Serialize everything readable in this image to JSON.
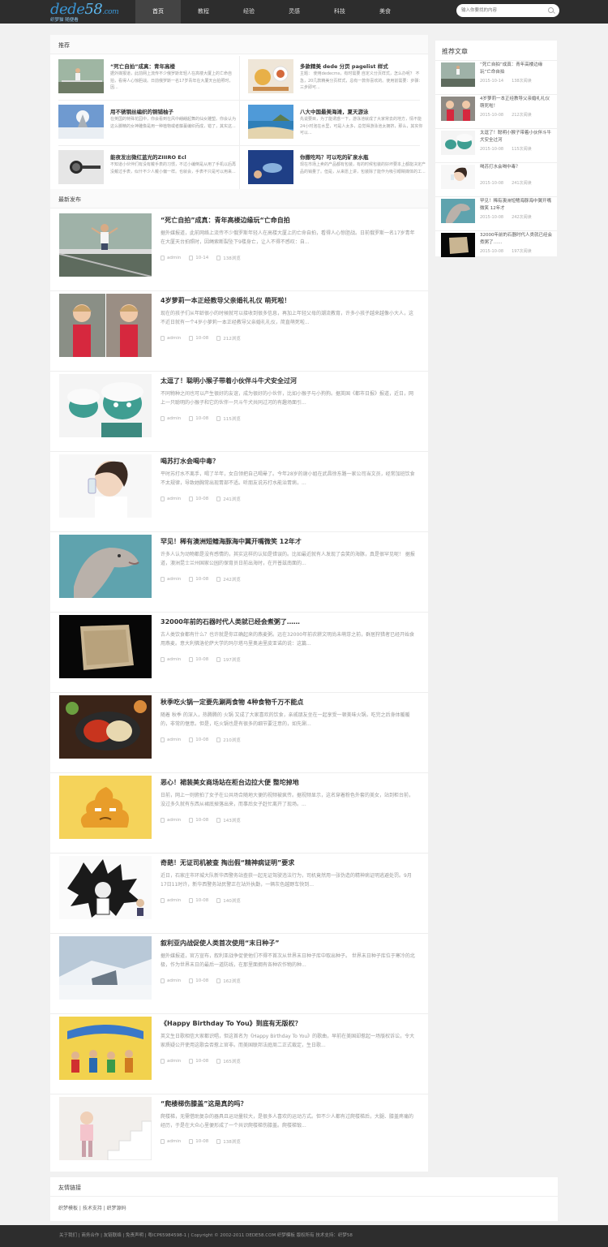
{
  "brand": {
    "logo_a": "dede",
    "logo_b": "58",
    "logo_c": ".com",
    "tagline": "织梦猫 随便看"
  },
  "nav": [
    "首页",
    "教程",
    "经验",
    "灵感",
    "科技",
    "美食"
  ],
  "search": {
    "placeholder": "输入你要找的内容"
  },
  "featured": {
    "title": "推荐",
    "items": [
      {
        "title": "“死亡自拍”成真：青年高楼",
        "desc": "据外媒报道，此前网上流传不少俄罗斯年轻人在高楼大厦上的亡命自拍，看得人心惊胆战。日前俄罗斯一名17岁青年在大厦天台拍照时，因..."
      },
      {
        "title": "多款精美 dede 分页 pagelist 样式",
        "desc": "主题： 使用dedecms，有时需要 自定义分页样式，怎么办呢？ 不急，20几款精美分页样式，总有一款你喜欢的。使用前需要：步骤：三步即可..."
      },
      {
        "title": "用不锈钢丝编织的铜铺柚子",
        "desc": "在英国的特殊花园中，你会看到在风中翩翩起舞的仙女雕塑。你会认为这么脚精的女神雕像是用一种植物或者藤蔓编织而成，错了，其实这..."
      },
      {
        "title": "八大中国最美海滩，夏天游泳",
        "desc": "先说要目，为了能诱惑一下，游泳池就成了大家常去的地方，情不能24小时泡在水里，可是人太多，总觉得游泳池太拥挤，那么，其实你可以..."
      },
      {
        "title": "能夜发出微红蓝光的ZIIIRO Ecl",
        "desc": "不知道小伙伴们有没有戴手表的习惯，不过小编倒是从用了手机以后再没戴过手表，似什不少人戴小偏一样。也就会，手表不只是可以用来..."
      },
      {
        "title": "你撒吃吗？可以吃的矿泉水瓶",
        "desc": "现在市场上卖的产品都有包装，有的时候包装的好坏要本上都能决定产品的销量了。但是，从来愿上讲，包装除了能作为吸引眼睛媒体的工..."
      }
    ]
  },
  "latest": {
    "title": "最新发布",
    "items": [
      {
        "title": "“死亡自拍”成真：青年高楼边缘玩“亡命自拍",
        "desc": "据外媒报道，此前网络上流传不少俄罗斯年轻人在高楼大厦上的亡命自拍，看得人心惊胆战。日前俄罗斯一名17岁青年在大厦天台拍照时，因绳索断裂坠下9楼身亡，让人不得不感叹：自...",
        "author": "admin",
        "date": "10-14",
        "views": "138浏览"
      },
      {
        "title": "4岁萝莉一本正经教导父亲婚礼礼仪 萌死啦！",
        "desc": "现在的孩子们从年龄很小的时候就可以接收到很多信息，再加上年轻父母的潮流教育，许多小孩子越来越像小大人，这不近日就有一个4岁小萝莉一本正经教导父亲婚礼礼仪，简直萌死啦...",
        "author": "admin",
        "date": "10-08",
        "views": "212浏览"
      },
      {
        "title": "太逗了！聪明小猴子带着小伙伴斗牛犬安全过河",
        "desc": "不同物种之间也可以产生很好的友谊，成为很好的小伙伴，比如小猴子与小狗狗。据英国《都市日报》报道，近日，网上一只聪明的小猴子和它的伙伴一只斗牛犬共同过河的有趣场面引...",
        "author": "admin",
        "date": "10-08",
        "views": "115浏览"
      },
      {
        "title": "喝苏打水会喝中毒？",
        "desc": "平时苏打水不离手，喝了半年，女白领把自己喝晕了。今年28岁的谢小姐在武昌徐东路一家公司当文员，经常加班饮食不太规律，导致她胸常出现胃部不适。听朋友说苏打水能治胃病，...",
        "author": "admin",
        "date": "10-08",
        "views": "241浏览"
      },
      {
        "title": "罕见！稀有澳洲短鳍海豚海中翼开嘴微笑 12年才",
        "desc": "许多人认为动物都是没有感情的，其实这样的认知是错误的。比如最近就有人发现了会笑的海豚，真是很罕见呢！ 据报道，澳洲昆士兰州国家公园的保育员日前出海时，在开普兹南面的...",
        "author": "admin",
        "date": "10-08",
        "views": "242浏览"
      },
      {
        "title": "32000年前的石器时代人类就已经会煮粥了……",
        "desc": "古人类饮食都有什么？也许就是你正确起来的燕麦粥。远在32000年前农耕文明尚未萌芽之前，群居狩猎者已经开始食用燕麦。意大利佛洛伦萨大学的玛尔塔马里奥迪里皮亚诺的说：这篇...",
        "author": "admin",
        "date": "10-08",
        "views": "197浏览"
      },
      {
        "title": "秋季吃火锅一定要先涮两食物 4种食物千万不能点",
        "desc": "随着 秋季 的深入，热腾腾的 火锅 又成了大家喜欢的饮食，亲戚朋友坐在一起享受一顿美味火锅，吃完之后身体暖暖的，非常的惬意。但是，吃火锅也是有很多的细节要注意的，如先涮...",
        "author": "admin",
        "date": "10-08",
        "views": "210浏览"
      },
      {
        "title": "恶心！裙装美女商场站在柜台边拉大便 整坨掉地",
        "desc": "日前，网上一则俯拍了女子在公共场合随地大便的视频被疯传。据视频显示，这名穿着粉色外套的美女，站到柜台前，没过多久就有东西从裙底掉落出来，而事后女子赶忙离开了现场。...",
        "author": "admin",
        "date": "10-08",
        "views": "143浏览"
      },
      {
        "title": "奇葩！无证司机被查 掏出假“精神病证明”要求",
        "desc": "近日，石家庄市环城大队新华西警务站查获一起无证驾驶违法行为，司机竟然用一张伪造的精神病证明逃避处罚。9月17日11时许，新华西警务站民警正在站外执勤，一辆灰色越野车快到...",
        "author": "admin",
        "date": "10-08",
        "views": "140浏览"
      },
      {
        "title": "叙利亚内战促使人类首次使用“末日种子”",
        "desc": "据外媒报道，官方宣布，叙利亚战争促使他们不得不首次从世界末日种子库中取出种子。 世界末日种子库位于寒冷的北极，作为世界末日的最后一道防线，在那里面拥有各种农作物的种...",
        "author": "admin",
        "date": "10-08",
        "views": "162浏览"
      },
      {
        "title": "《Happy Birthday To You》到底有无版权？",
        "desc": "英文生日歌相信大家都识唱，但这首名为《Happy Birthday To You》的歌曲，早前在美国却惹起一场版权诉讼，令大家质疑公开使用这歌会否惹上官非。而美国联邦法庭周二正式裁定，生日歌...",
        "author": "admin",
        "date": "10-08",
        "views": "165浏览"
      },
      {
        "title": "“爬楼梯伤膝盖”这是真的吗？",
        "desc": "爬楼梯，无需借助复杂的器具且运动量较大，是很多人喜欢的运动方式。但不少人都有过爬楼梯后，大腿、膝盖疼痛的经历，于是在大众心里便形成了一个共识爬楼梯伤膝盖。爬楼梯锻...",
        "author": "admin",
        "date": "10-08",
        "views": "138浏览"
      }
    ]
  },
  "sidebar": {
    "title": "推荐文章",
    "items": [
      {
        "title": "“死亡自拍”成真：青年高楼边缘玩“亡命自拍",
        "date": "2015-10-14",
        "views": "138次阅读"
      },
      {
        "title": "4岁萝莉一本正经教导父亲婚礼礼仪 萌死啦！",
        "date": "2015-10-08",
        "views": "212次阅读"
      },
      {
        "title": "太逗了！聪明小猴子带着小伙伴斗牛犬安全过河",
        "date": "2015-10-08",
        "views": "115次阅读"
      },
      {
        "title": "喝苏打水会喝中毒？",
        "date": "2015-10-08",
        "views": "241次阅读"
      },
      {
        "title": "罕见！稀有澳洲短鳍海豚海中翼开嘴微笑 12年才",
        "date": "2015-10-08",
        "views": "242次阅读"
      },
      {
        "title": "32000年前的石器时代人类就已经会煮粥了……",
        "date": "2015-10-08",
        "views": "197次阅读"
      }
    ]
  },
  "links": {
    "title": "友情链接",
    "text": "织梦模板 | 技术支持 | 织梦源码"
  },
  "footer": {
    "text": "关于我们 | 商务合作 | 友链联络 | 免责声明 | 粤ICP65984598-1 | Copyright © 2002-2011 DEDE58.COM 织梦模板 版权所有 技术支持：织梦58"
  },
  "colors": {
    "topbar": "#2d2d2d",
    "accent": "#3a96d6",
    "page_bg": "#f1f1f1"
  }
}
